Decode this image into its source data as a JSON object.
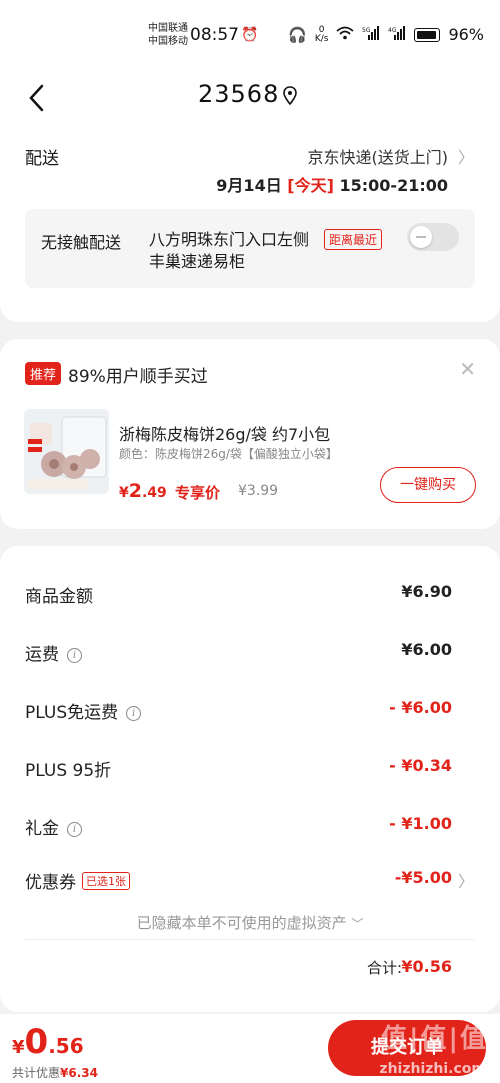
{
  "status_bar": {
    "carrier_1": "中国联通",
    "carrier_2": "中国移动",
    "time": "08:57",
    "net_speed_value": "0",
    "net_speed_unit": "K/s",
    "battery": "96%"
  },
  "header": {
    "title": "23568"
  },
  "delivery": {
    "label": "配送",
    "courier": "京东快递(送货上门)",
    "date": "9月14日",
    "today": "[今天]",
    "window": "15:00-21:00",
    "contactless_label": "无接触配送",
    "address": "八方明珠东门入口左侧丰巢速递易柜",
    "nearest_tag": "距离最近"
  },
  "recommend": {
    "tag": "推荐",
    "text": "89%用户顺手买过",
    "product_name": "浙梅陈皮梅饼26g/袋 约7小包",
    "product_spec": "颜色：陈皮梅饼26g/袋【偏酸独立小袋】",
    "price_currency": "¥",
    "price_int": "2",
    "price_dec": ".49",
    "exclusive_label": "专享价",
    "original_price": "¥3.99",
    "buy_button": "一键购买"
  },
  "fees": {
    "goods_label": "商品金额",
    "goods_value": "¥6.90",
    "shipping_label": "运费",
    "shipping_value": "¥6.00",
    "plus_free_label": "PLUS免运费",
    "plus_free_value": "- ¥6.00",
    "plus_discount_label": "PLUS 95折",
    "plus_discount_value": "- ¥0.34",
    "gift_label": "礼金",
    "gift_value": "- ¥1.00",
    "coupon_label": "优惠券",
    "coupon_tag": "已选1张",
    "coupon_value": "-¥5.00",
    "hidden_assets": "已隐藏本单不可使用的虚拟资产",
    "total_label": "合计:",
    "total_value": "¥0.56"
  },
  "bottom_bar": {
    "currency": "¥",
    "amount_int": "0",
    "amount_dec": ".56",
    "saved_label": "共计优惠",
    "saved_value": "¥6.34",
    "submit_label": "提交订单",
    "watermark": "值|值|值",
    "watermark_site": "zhizhizhi.com"
  },
  "colors": {
    "accent": "#e2231a",
    "background": "#f2f2f2"
  }
}
